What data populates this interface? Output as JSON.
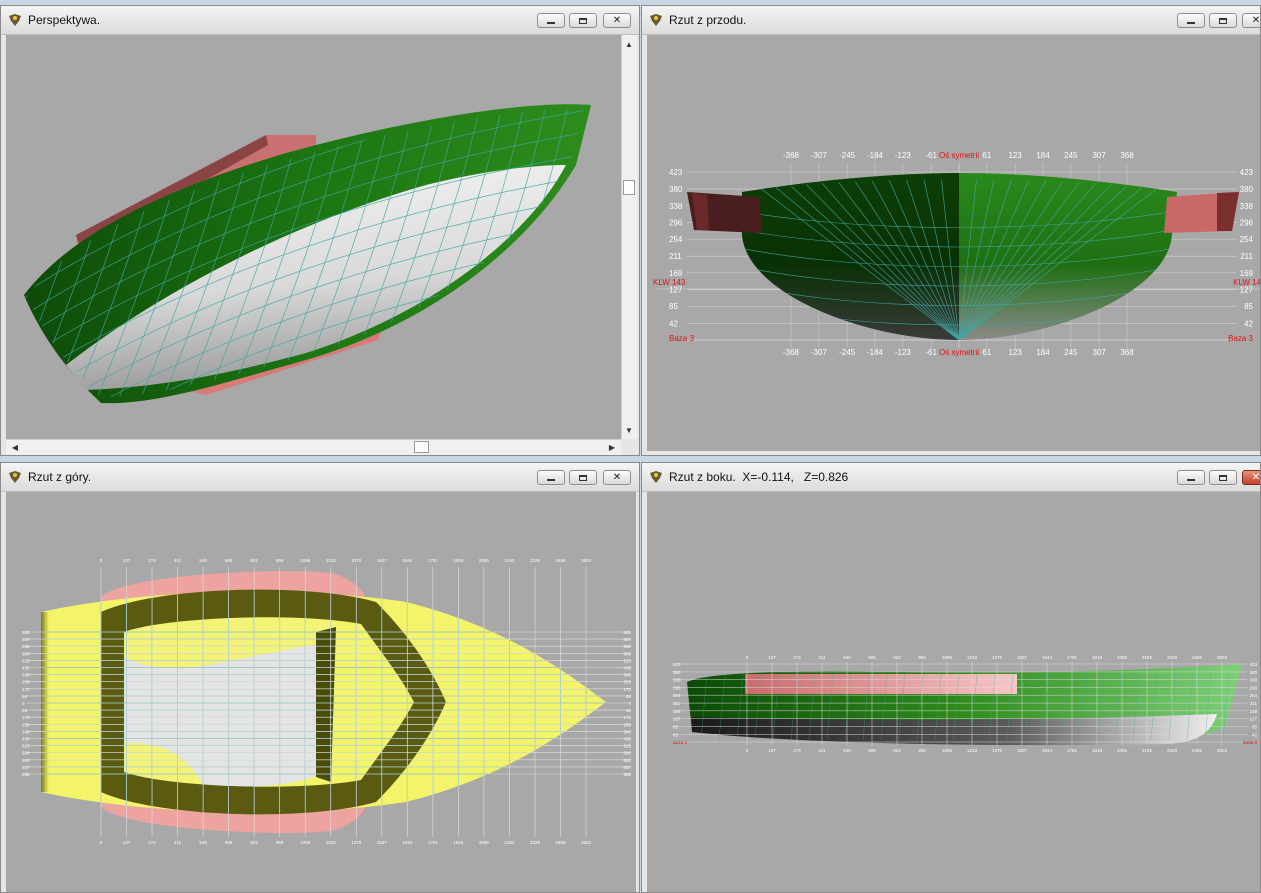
{
  "windows": {
    "perspective": {
      "title": "Perspektywa."
    },
    "front": {
      "title": "Rzut z przodu.",
      "x_ticks": [
        "-368",
        "-307",
        "-245",
        "-184",
        "-123",
        "-61",
        "61",
        "123",
        "184",
        "245",
        "307",
        "368"
      ],
      "symmetry_label": "Oś symetrii",
      "y_ticks": [
        "423",
        "380",
        "338",
        "296",
        "254",
        "211",
        "169",
        "127",
        "85",
        "42"
      ],
      "klw_left": "KLW 143",
      "klw_right": "KLW 14",
      "base_label": "Baza 3"
    },
    "top": {
      "title": "Rzut z góry.",
      "x_ticks": [
        "0",
        "137",
        "274",
        "411",
        "548",
        "685",
        "822",
        "959",
        "1096",
        "1233",
        "1370",
        "1507",
        "1644",
        "1781",
        "1918",
        "2055",
        "2192",
        "2329",
        "2466",
        "2603"
      ],
      "y_ticks": [
        "885",
        "807",
        "690",
        "600",
        "515",
        "430",
        "345",
        "258",
        "172",
        "86",
        "0",
        "86",
        "172",
        "258",
        "345",
        "430",
        "515",
        "600",
        "690",
        "807",
        "885"
      ]
    },
    "side": {
      "title": "Rzut z boku.",
      "coords": "X=-0.114,   Z=0.826",
      "x_ticks": [
        "0",
        "137",
        "274",
        "411",
        "548",
        "685",
        "822",
        "959",
        "1096",
        "1233",
        "1370",
        "1507",
        "1644",
        "1781",
        "1918",
        "2055",
        "2192",
        "2329",
        "2466",
        "2603"
      ],
      "y_ticks": [
        "423",
        "380",
        "338",
        "296",
        "254",
        "211",
        "169",
        "127",
        "85",
        "42"
      ],
      "base_label": "Baza 3"
    }
  },
  "colors": {
    "viewport_bg": "#a8a8a8",
    "hull_green": "#1f6f12",
    "hull_white": "#e4e4e4",
    "gunwale_pink": "#d77a78",
    "deck_yellow": "#f4f46a",
    "grid_cyan": "#3fa7a3",
    "label_red": "#e01010"
  },
  "icons": [
    "app-icon",
    "minimize-icon",
    "maximize-icon",
    "close-icon",
    "scroll-up-icon",
    "scroll-down-icon",
    "scroll-left-icon",
    "scroll-right-icon"
  ]
}
